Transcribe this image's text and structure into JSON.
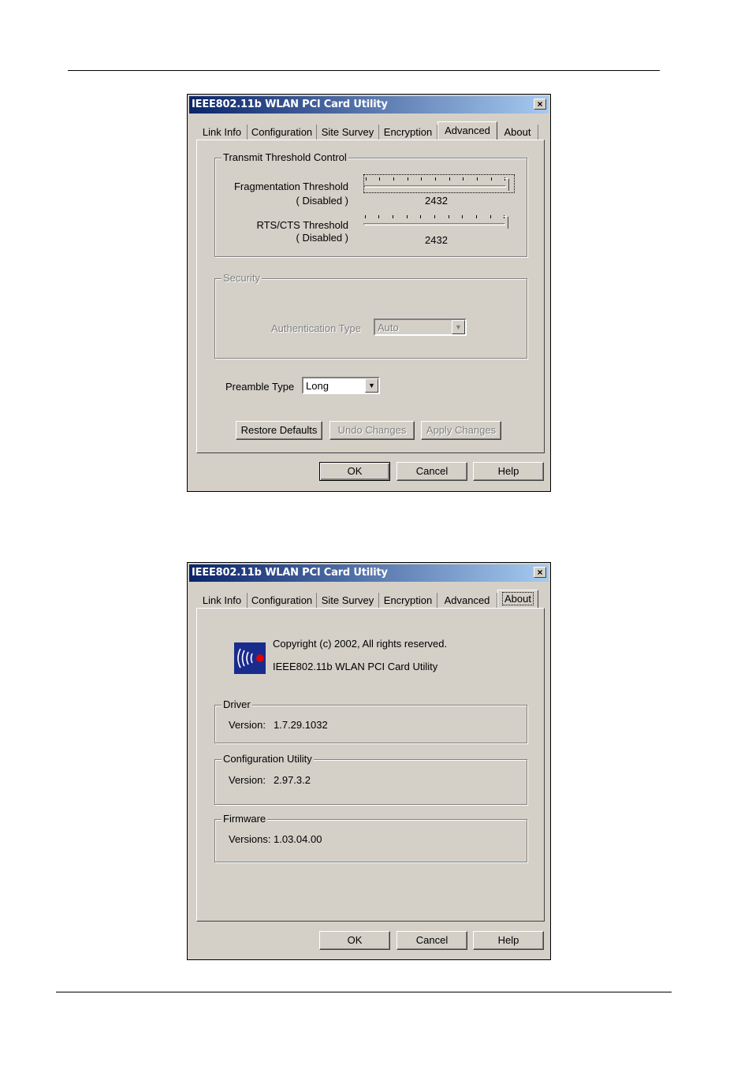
{
  "window_title": "IEEE802.11b WLAN PCI Card Utility",
  "close_label": "×",
  "tabs": [
    "Link Info",
    "Configuration",
    "Site Survey",
    "Encryption",
    "Advanced",
    "About"
  ],
  "advanced": {
    "transmit_group": "Transmit Threshold Control",
    "frag_label": "Fragmentation Threshold",
    "frag_state": "( Disabled )",
    "frag_value": "2432",
    "rts_label": "RTS/CTS Threshold",
    "rts_state": "( Disabled )",
    "rts_value": "2432",
    "security_group": "Security",
    "auth_label": "Authentication Type",
    "auth_value": "Auto",
    "preamble_label": "Preamble Type",
    "preamble_value": "Long",
    "restore_label": "Restore Defaults",
    "undo_label": "Undo Changes",
    "apply_label": "Apply Changes"
  },
  "about": {
    "copyright": "Copyright (c) 2002, All rights reserved.",
    "product": "IEEE802.11b WLAN PCI Card Utility",
    "driver_group": "Driver",
    "driver_version_label": "Version:",
    "driver_version": "1.7.29.1032",
    "config_group": "Configuration Utility",
    "config_version_label": "Version:",
    "config_version": "2.97.3.2",
    "firmware_group": "Firmware",
    "firmware_version_label": "Versions:",
    "firmware_version": "1.03.04.00"
  },
  "buttons": {
    "ok": "OK",
    "cancel": "Cancel",
    "help": "Help"
  },
  "colors": {
    "dialog_bg": "#d4d0c8",
    "title_start": "#0a246a",
    "title_end": "#a6caf0",
    "logo_bg": "#1a2b8e",
    "logo_dot": "#e00000"
  }
}
